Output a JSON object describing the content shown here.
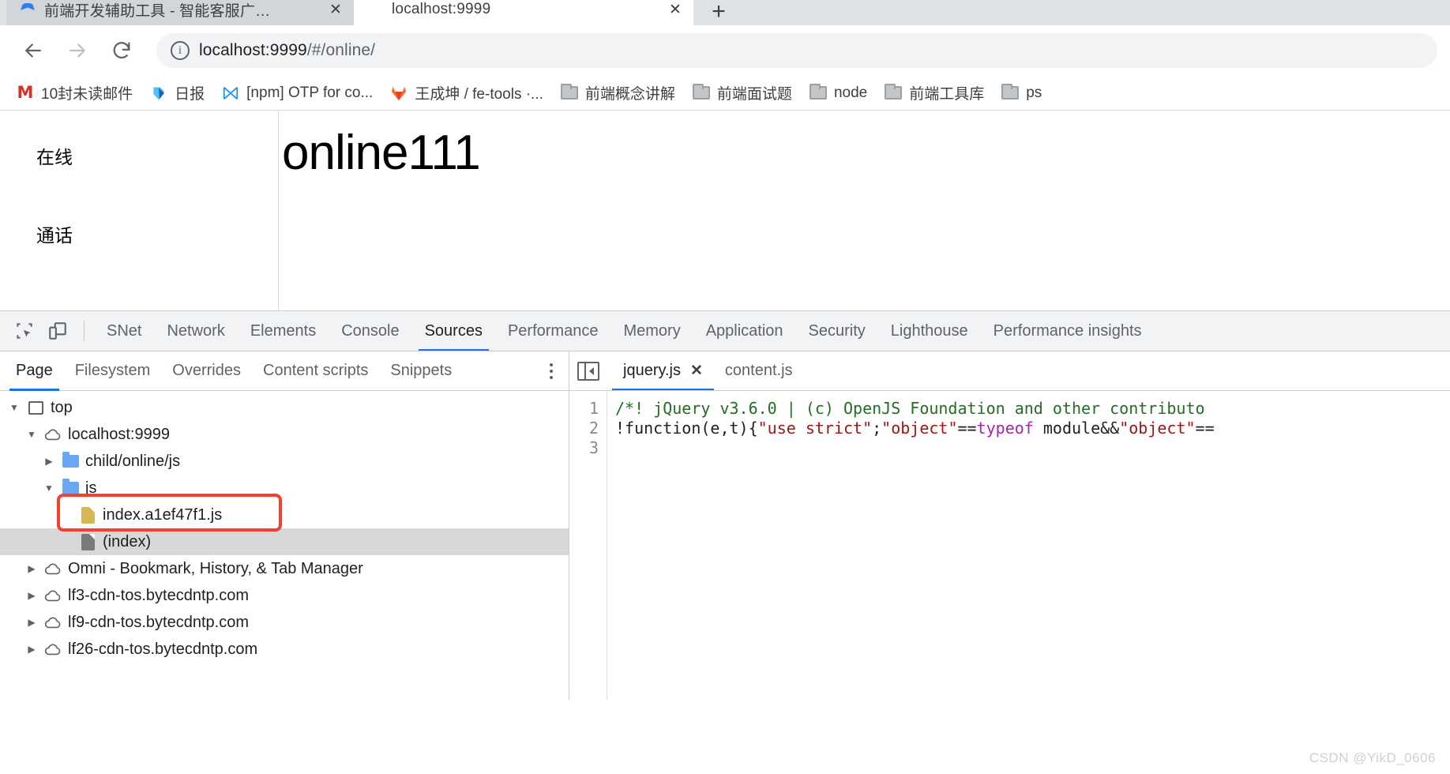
{
  "browser": {
    "tabs": [
      {
        "title": "前端开发辅助工具 - 智能客服广…",
        "favicon": "blue-logo-icon",
        "active": false,
        "close_label": "✕"
      },
      {
        "title": "localhost:9999",
        "favicon": "globe-icon",
        "active": true,
        "close_label": "✕"
      }
    ],
    "new_tab_label": "+",
    "toolbar": {
      "back_label": "Back",
      "forward_label": "Forward",
      "reload_label": "Reload",
      "url": "localhost:9999/#/online/",
      "url_host": "localhost:9999",
      "url_path": "/#/online/",
      "site_info_label": "i"
    },
    "bookmarks": [
      {
        "label": "10封未读邮件",
        "icon": "gmail-icon"
      },
      {
        "label": "日报",
        "icon": "doc-icon"
      },
      {
        "label": "[npm] OTP for co...",
        "icon": "npm-icon"
      },
      {
        "label": "王成坤 / fe-tools ·...",
        "icon": "gitlab-icon"
      },
      {
        "label": "前端概念讲解",
        "icon": "folder-icon"
      },
      {
        "label": "前端面试题",
        "icon": "folder-icon"
      },
      {
        "label": "node",
        "icon": "folder-icon"
      },
      {
        "label": "前端工具库",
        "icon": "folder-icon"
      },
      {
        "label": "ps",
        "icon": "folder-icon"
      }
    ]
  },
  "page": {
    "sidebar_items": [
      "在线",
      "通话"
    ],
    "heading": "online111"
  },
  "devtools": {
    "tools": [
      {
        "label": "inspect-element-icon"
      },
      {
        "label": "device-toolbar-icon"
      }
    ],
    "tabs": [
      {
        "label": "SNet",
        "active": false
      },
      {
        "label": "Network",
        "active": false
      },
      {
        "label": "Elements",
        "active": false
      },
      {
        "label": "Console",
        "active": false
      },
      {
        "label": "Sources",
        "active": true
      },
      {
        "label": "Performance",
        "active": false
      },
      {
        "label": "Memory",
        "active": false
      },
      {
        "label": "Application",
        "active": false
      },
      {
        "label": "Security",
        "active": false
      },
      {
        "label": "Lighthouse",
        "active": false
      },
      {
        "label": "Performance insights",
        "active": false
      }
    ],
    "subtabs": [
      {
        "label": "Page",
        "active": true
      },
      {
        "label": "Filesystem",
        "active": false
      },
      {
        "label": "Overrides",
        "active": false
      },
      {
        "label": "Content scripts",
        "active": false
      },
      {
        "label": "Snippets",
        "active": false
      }
    ],
    "tree": [
      {
        "label": "top",
        "icon": "frame-icon",
        "twisty": "open",
        "indent": 0,
        "selected": false
      },
      {
        "label": "localhost:9999",
        "icon": "cloud-icon",
        "twisty": "open",
        "indent": 1,
        "selected": false
      },
      {
        "label": "child/online/js",
        "icon": "folder-icon",
        "twisty": "closed",
        "indent": 2,
        "selected": false
      },
      {
        "label": "js",
        "icon": "folder-icon",
        "twisty": "open",
        "indent": 2,
        "selected": false
      },
      {
        "label": "index.a1ef47f1.js",
        "icon": "js-file-icon",
        "twisty": "blank",
        "indent": 3,
        "selected": false
      },
      {
        "label": "(index)",
        "icon": "doc-file-icon",
        "twisty": "blank",
        "indent": 2,
        "selected": true
      },
      {
        "label": "Omni - Bookmark, History, & Tab Manager",
        "icon": "cloud-icon",
        "twisty": "closed",
        "indent": 1,
        "selected": false
      },
      {
        "label": "lf3-cdn-tos.bytecdntp.com",
        "icon": "cloud-icon",
        "twisty": "closed",
        "indent": 1,
        "selected": false
      },
      {
        "label": "lf9-cdn-tos.bytecdntp.com",
        "icon": "cloud-icon",
        "twisty": "closed",
        "indent": 1,
        "selected": false
      },
      {
        "label": "lf26-cdn-tos.bytecdntp.com",
        "icon": "cloud-icon",
        "twisty": "closed",
        "indent": 1,
        "selected": false
      }
    ],
    "highlight": {
      "target": "index.a1ef47f1.js",
      "color": "#f5402c"
    },
    "editor": {
      "panel_toggle_label": "show-navigator-icon",
      "tabs": [
        {
          "label": "jquery.js",
          "active": true,
          "close_label": "✕"
        },
        {
          "label": "content.js",
          "active": false
        }
      ],
      "line_numbers": [
        "1",
        "2",
        "3"
      ],
      "code": {
        "line1_comment": "/*! jQuery v3.6.0 | (c) OpenJS Foundation and other contributo",
        "line2_part1": "!function(e,t){",
        "line2_str1": "\"use strict\"",
        "line2_semi": ";",
        "line2_str2": "\"object\"",
        "line2_eq1": "==",
        "line2_kw": "typeof",
        "line2_mid": " module&&",
        "line2_str3": "\"object\"",
        "line2_eq2": "=="
      }
    }
  },
  "watermark": "CSDN @YikD_0606"
}
